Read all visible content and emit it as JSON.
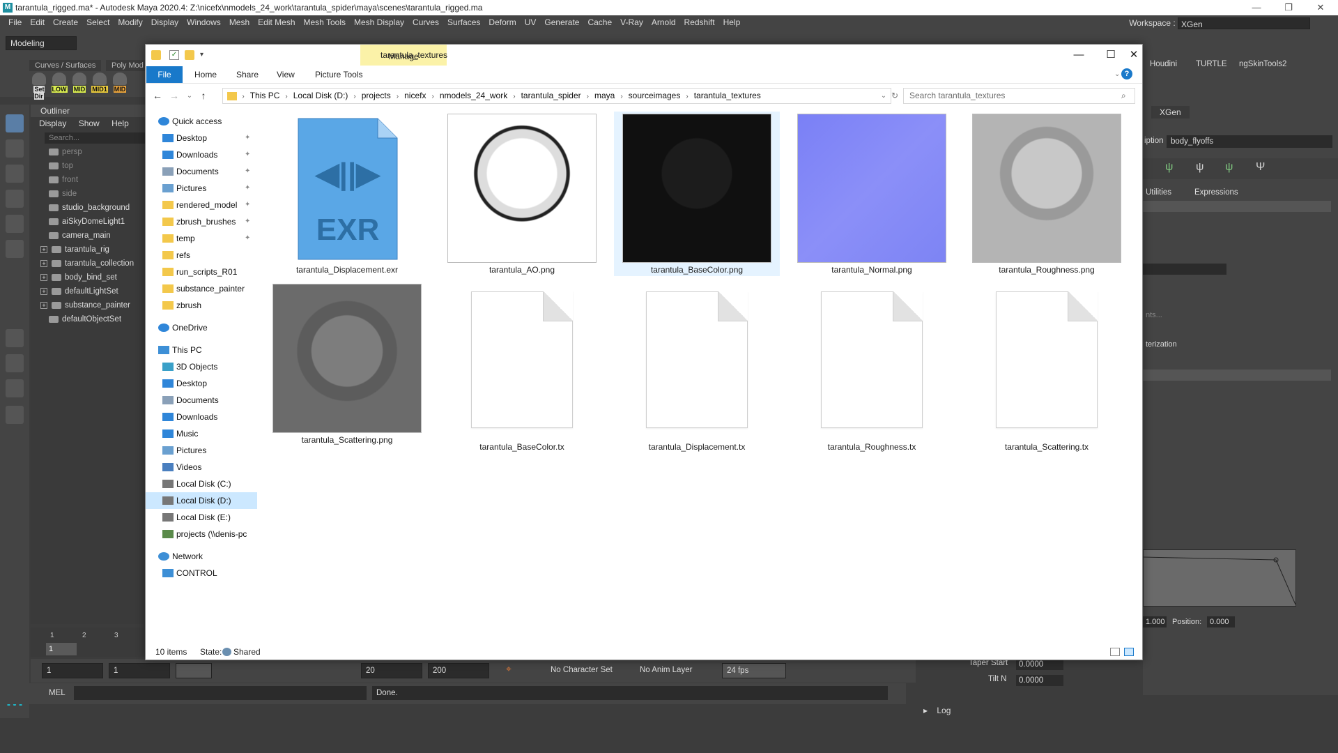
{
  "maya": {
    "title": "tarantula_rigged.ma* - Autodesk Maya 2020.4: Z:\\nicefx\\nmodels_24_work\\tarantula_spider\\maya\\scenes\\tarantula_rigged.ma",
    "menu": [
      "File",
      "Edit",
      "Create",
      "Select",
      "Modify",
      "Display",
      "Windows",
      "Mesh",
      "Edit Mesh",
      "Mesh Tools",
      "Mesh Display",
      "Curves",
      "Surfaces",
      "Deform",
      "UV",
      "Generate",
      "Cache",
      "V-Ray",
      "Arnold",
      "Redshift",
      "Help"
    ],
    "workspace_label": "Workspace :",
    "workspace_value": "XGen",
    "mode": "Modeling",
    "shelf_tabs": [
      "Curves / Surfaces",
      "Poly Mod"
    ],
    "shelf_buttons": [
      "Set Dir",
      "LOW",
      "MID",
      "MID1",
      "MID"
    ],
    "right_tabs": [
      "Houdini",
      "TURTLE",
      "ngSkinTools2"
    ],
    "xgen": {
      "tab": "XGen",
      "description_label": "iption",
      "description_value": "body_flyoffs",
      "subtabs": [
        "Utilities",
        "Expressions"
      ],
      "text1": "nts...",
      "text2": "terization",
      "value_a": "1.000",
      "position_label": "Position:",
      "position_value": "0.000",
      "taper_label": "Taper Start",
      "taper_value": "0.0000",
      "tilt_label": "Tilt N",
      "tilt_value": "0.0000"
    },
    "outliner": {
      "title": "Outliner",
      "menu": [
        "Display",
        "Show",
        "Help"
      ],
      "search_placeholder": "Search...",
      "items": [
        {
          "label": "persp",
          "dim": true,
          "expand": false
        },
        {
          "label": "top",
          "dim": true,
          "expand": false
        },
        {
          "label": "front",
          "dim": true,
          "expand": false
        },
        {
          "label": "side",
          "dim": true,
          "expand": false
        },
        {
          "label": "studio_background",
          "dim": false,
          "expand": false
        },
        {
          "label": "aiSkyDomeLight1",
          "dim": false,
          "expand": false
        },
        {
          "label": "camera_main",
          "dim": false,
          "expand": false
        },
        {
          "label": "tarantula_rig",
          "dim": false,
          "expand": true
        },
        {
          "label": "tarantula_collection",
          "dim": false,
          "expand": true
        },
        {
          "label": "body_bind_set",
          "dim": false,
          "expand": true
        },
        {
          "label": "defaultLightSet",
          "dim": false,
          "expand": true
        },
        {
          "label": "substance_painter",
          "dim": false,
          "expand": true
        },
        {
          "label": "defaultObjectSet",
          "dim": false,
          "expand": false
        }
      ]
    },
    "timeline_ticks": [
      "1",
      "2",
      "3"
    ],
    "range": {
      "start": "1",
      "start2": "1",
      "frame": "1",
      "end": "20",
      "end2": "200",
      "char_set": "No Character Set",
      "anim_layer": "No Anim Layer",
      "fps": "24 fps"
    },
    "cmd": {
      "lang": "MEL",
      "result": "Done."
    },
    "log": "Log"
  },
  "explorer": {
    "manage": "Manage",
    "title": "tarantula_textures",
    "ribbon": {
      "file": "File",
      "tabs": [
        "Home",
        "Share",
        "View",
        "Picture Tools"
      ]
    },
    "breadcrumb": [
      "This PC",
      "Local Disk (D:)",
      "projects",
      "nicefx",
      "nmodels_24_work",
      "tarantula_spider",
      "maya",
      "sourceimages",
      "tarantula_textures"
    ],
    "search_placeholder": "Search tarantula_textures",
    "nav": [
      {
        "label": "Quick access",
        "icon": "star",
        "indent": 0,
        "pin": false,
        "sel": false
      },
      {
        "label": "Desktop",
        "icon": "desktop",
        "indent": 1,
        "pin": true,
        "sel": false
      },
      {
        "label": "Downloads",
        "icon": "download",
        "indent": 1,
        "pin": true,
        "sel": false
      },
      {
        "label": "Documents",
        "icon": "documents",
        "indent": 1,
        "pin": true,
        "sel": false
      },
      {
        "label": "Pictures",
        "icon": "pictures",
        "indent": 1,
        "pin": true,
        "sel": false
      },
      {
        "label": "rendered_model",
        "icon": "folder",
        "indent": 1,
        "pin": true,
        "sel": false
      },
      {
        "label": "zbrush_brushes",
        "icon": "folder",
        "indent": 1,
        "pin": true,
        "sel": false
      },
      {
        "label": "temp",
        "icon": "folder",
        "indent": 1,
        "pin": true,
        "sel": false
      },
      {
        "label": "refs",
        "icon": "folder",
        "indent": 1,
        "pin": false,
        "sel": false
      },
      {
        "label": "run_scripts_R01",
        "icon": "folder",
        "indent": 1,
        "pin": false,
        "sel": false
      },
      {
        "label": "substance_painter",
        "icon": "folder",
        "indent": 1,
        "pin": false,
        "sel": false
      },
      {
        "label": "zbrush",
        "icon": "folder",
        "indent": 1,
        "pin": false,
        "sel": false
      },
      {
        "label": "",
        "icon": "",
        "indent": 0,
        "pin": false,
        "sel": false
      },
      {
        "label": "OneDrive",
        "icon": "cloud",
        "indent": 0,
        "pin": false,
        "sel": false
      },
      {
        "label": "",
        "icon": "",
        "indent": 0,
        "pin": false,
        "sel": false
      },
      {
        "label": "This PC",
        "icon": "pc",
        "indent": 0,
        "pin": false,
        "sel": false
      },
      {
        "label": "3D Objects",
        "icon": "cube",
        "indent": 1,
        "pin": false,
        "sel": false
      },
      {
        "label": "Desktop",
        "icon": "desktop",
        "indent": 1,
        "pin": false,
        "sel": false
      },
      {
        "label": "Documents",
        "icon": "documents",
        "indent": 1,
        "pin": false,
        "sel": false
      },
      {
        "label": "Downloads",
        "icon": "download",
        "indent": 1,
        "pin": false,
        "sel": false
      },
      {
        "label": "Music",
        "icon": "music",
        "indent": 1,
        "pin": false,
        "sel": false
      },
      {
        "label": "Pictures",
        "icon": "pictures",
        "indent": 1,
        "pin": false,
        "sel": false
      },
      {
        "label": "Videos",
        "icon": "videos",
        "indent": 1,
        "pin": false,
        "sel": false
      },
      {
        "label": "Local Disk (C:)",
        "icon": "drive",
        "indent": 1,
        "pin": false,
        "sel": false
      },
      {
        "label": "Local Disk (D:)",
        "icon": "drive",
        "indent": 1,
        "pin": false,
        "sel": true
      },
      {
        "label": "Local Disk (E:)",
        "icon": "drive",
        "indent": 1,
        "pin": false,
        "sel": false
      },
      {
        "label": "projects (\\\\denis-pc",
        "icon": "netdrive",
        "indent": 1,
        "pin": false,
        "sel": false
      },
      {
        "label": "",
        "icon": "",
        "indent": 0,
        "pin": false,
        "sel": false
      },
      {
        "label": "Network",
        "icon": "network",
        "indent": 0,
        "pin": false,
        "sel": false
      },
      {
        "label": "CONTROL",
        "icon": "pc",
        "indent": 1,
        "pin": false,
        "sel": false
      }
    ],
    "files": [
      {
        "name": "tarantula_Displacement.exr",
        "kind": "exr",
        "sel": false
      },
      {
        "name": "tarantula_AO.png",
        "kind": "ao",
        "sel": false
      },
      {
        "name": "tarantula_BaseColor.png",
        "kind": "basecolor",
        "sel": true
      },
      {
        "name": "tarantula_Normal.png",
        "kind": "normal",
        "sel": false
      },
      {
        "name": "tarantula_Roughness.png",
        "kind": "rough",
        "sel": false
      },
      {
        "name": "tarantula_Scattering.png",
        "kind": "scatter",
        "sel": false
      },
      {
        "name": "tarantula_BaseColor.tx",
        "kind": "doc",
        "sel": false
      },
      {
        "name": "tarantula_Displacement.tx",
        "kind": "doc",
        "sel": false
      },
      {
        "name": "tarantula_Roughness.tx",
        "kind": "doc",
        "sel": false
      },
      {
        "name": "tarantula_Scattering.tx",
        "kind": "doc",
        "sel": false
      }
    ],
    "exr_badge": "EXR",
    "status": {
      "count": "10 items",
      "state_label": "State:",
      "state_value": "Shared"
    }
  }
}
